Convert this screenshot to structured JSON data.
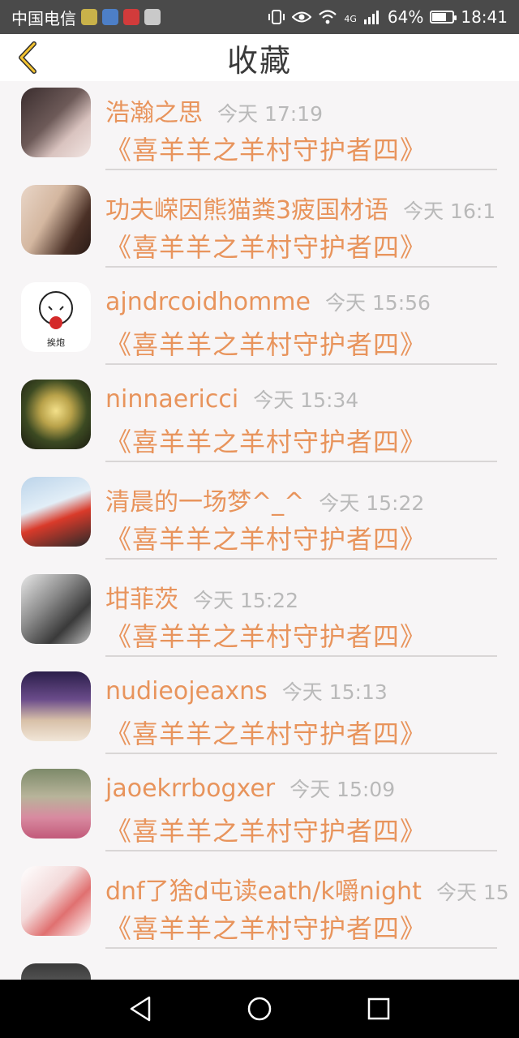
{
  "status_bar": {
    "carrier": "中国电信",
    "network": "4G",
    "battery_percent": "64%",
    "time": "18:41"
  },
  "header": {
    "title": "收藏"
  },
  "colors": {
    "accent": "#e8945c",
    "time_gray": "#b9b9b9",
    "title": "#3a3a3a"
  },
  "favorites": [
    {
      "user": "浩瀚之思",
      "time": "今天 17:19",
      "book": "《喜羊羊之羊村守护者四》"
    },
    {
      "user": "功夫嵘因熊猫粪3疲国材语",
      "time": "今天 16:1",
      "book": "《喜羊羊之羊村守护者四》"
    },
    {
      "user": "ajndrcoidhomme",
      "time": "今天 15:56",
      "book": "《喜羊羊之羊村守护者四》"
    },
    {
      "user": "ninnaericci",
      "time": "今天 15:34",
      "book": "《喜羊羊之羊村守护者四》"
    },
    {
      "user": "清晨的一场梦^_^",
      "time": "今天 15:22",
      "book": "《喜羊羊之羊村守护者四》"
    },
    {
      "user": "坩菲茨",
      "time": "今天 15:22",
      "book": "《喜羊羊之羊村守护者四》"
    },
    {
      "user": "nudieojeaxns",
      "time": "今天 15:13",
      "book": "《喜羊羊之羊村守护者四》"
    },
    {
      "user": "jaoekrrbogxer",
      "time": "今天 15:09",
      "book": "《喜羊羊之羊村守护者四》"
    },
    {
      "user": "dnf了猞d屯读eath/k嚼night",
      "time": "今天 15",
      "book": "《喜羊羊之羊村守护者四》"
    }
  ]
}
